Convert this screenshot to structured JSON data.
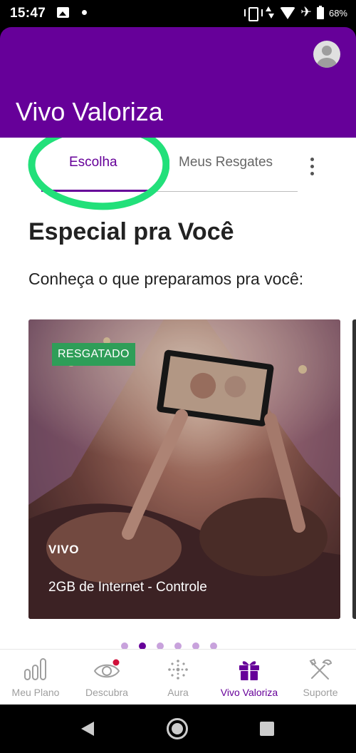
{
  "status_bar": {
    "time": "15:47",
    "battery": "68%",
    "icons": [
      "image-icon",
      "notification-dot-icon",
      "vibrate-icon",
      "data-arrows-icon",
      "wifi-icon",
      "airplane-mode-icon",
      "battery-icon"
    ]
  },
  "header": {
    "title": "Vivo Valoriza",
    "avatar_icon": "user-avatar-icon"
  },
  "tabs": {
    "items": [
      {
        "label": "Escolha",
        "active": true
      },
      {
        "label": "Meus Resgates",
        "active": false
      }
    ],
    "menu_icon": "more-vert-icon"
  },
  "section": {
    "title": "Especial pra Você",
    "subtitle": "Conheça o que preparamos pra você:"
  },
  "carousel": {
    "card": {
      "badge": "RESGATADO",
      "brand": "VIVO",
      "name": "2GB de Internet - Controle"
    },
    "page_count": 6,
    "active_index": 1
  },
  "bottom_nav": {
    "items": [
      {
        "label": "Meu Plano",
        "icon": "bar-chart-icon",
        "active": false
      },
      {
        "label": "Descubra",
        "icon": "eye-icon",
        "active": false
      },
      {
        "label": "Aura",
        "icon": "aura-dots-icon",
        "active": false
      },
      {
        "label": "Vivo Valoriza",
        "icon": "gift-icon",
        "active": true
      },
      {
        "label": "Suporte",
        "icon": "tools-icon",
        "active": false
      }
    ]
  },
  "colors": {
    "brand_purple": "#660099",
    "badge_green": "#2e9e58",
    "annotation_green": "#22e07a",
    "notification_red": "#d0103a"
  }
}
